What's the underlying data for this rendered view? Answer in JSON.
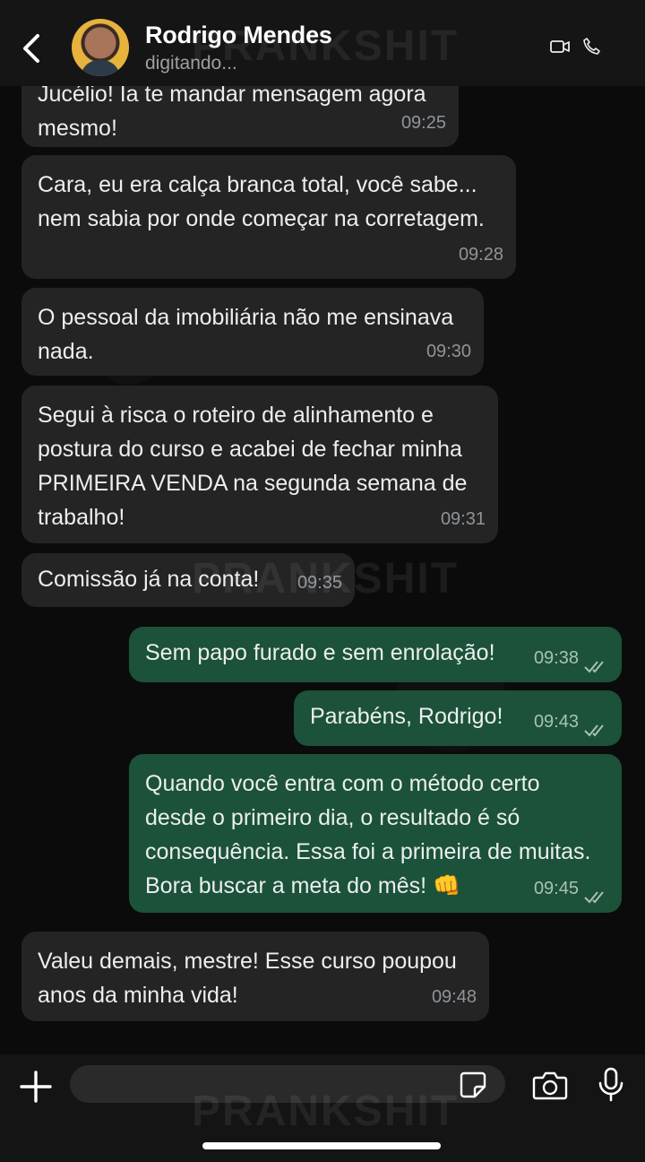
{
  "header": {
    "contact_name": "Rodrigo Mendes",
    "status": "digitando..."
  },
  "watermark": "PRANKSHIT",
  "messages": [
    {
      "direction": "in",
      "text": "Jucélio! Ia te mandar mensagem agora\nmesmo!",
      "time": "09:25"
    },
    {
      "direction": "in",
      "text": "Cara, eu era calça branca total, você sabe...\nnem sabia por onde começar na corretagem.",
      "time": "09:28"
    },
    {
      "direction": "in",
      "text": "O pessoal da imobiliária não me ensinava\nnada.",
      "time": "09:30"
    },
    {
      "direction": "in",
      "text": "Segui à risca o roteiro de alinhamento e\npostura do curso e acabei de fechar minha\nPRIMEIRA VENDA na segunda semana de\ntrabalho!",
      "time": "09:31"
    },
    {
      "direction": "in",
      "text": "Comissão já na conta!",
      "time": "09:35"
    },
    {
      "direction": "out",
      "text": "Sem papo furado e sem enrolação!",
      "time": "09:38",
      "status": "read"
    },
    {
      "direction": "out",
      "text": "Parabéns, Rodrigo!",
      "time": "09:43",
      "status": "read"
    },
    {
      "direction": "out",
      "text": "Quando você entra com o método certo\ndesde o primeiro dia, o resultado é só\nconsequência. Essa foi a primeira de muitas.\nBora buscar a meta do mês! 👊",
      "time": "09:45",
      "status": "read"
    },
    {
      "direction": "in",
      "text": "Valeu demais, mestre! Esse curso poupou\nanos da minha vida!",
      "time": "09:48"
    }
  ],
  "composer": {
    "input_value": ""
  },
  "colors": {
    "incoming_bubble": "#242424",
    "outgoing_bubble": "#1b5239",
    "header_bg": "#151515"
  },
  "icons": [
    "back-arrow-icon",
    "video-call-icon",
    "phone-icon",
    "plus-icon",
    "sticker-icon",
    "camera-icon",
    "microphone-icon",
    "double-check-icon"
  ]
}
